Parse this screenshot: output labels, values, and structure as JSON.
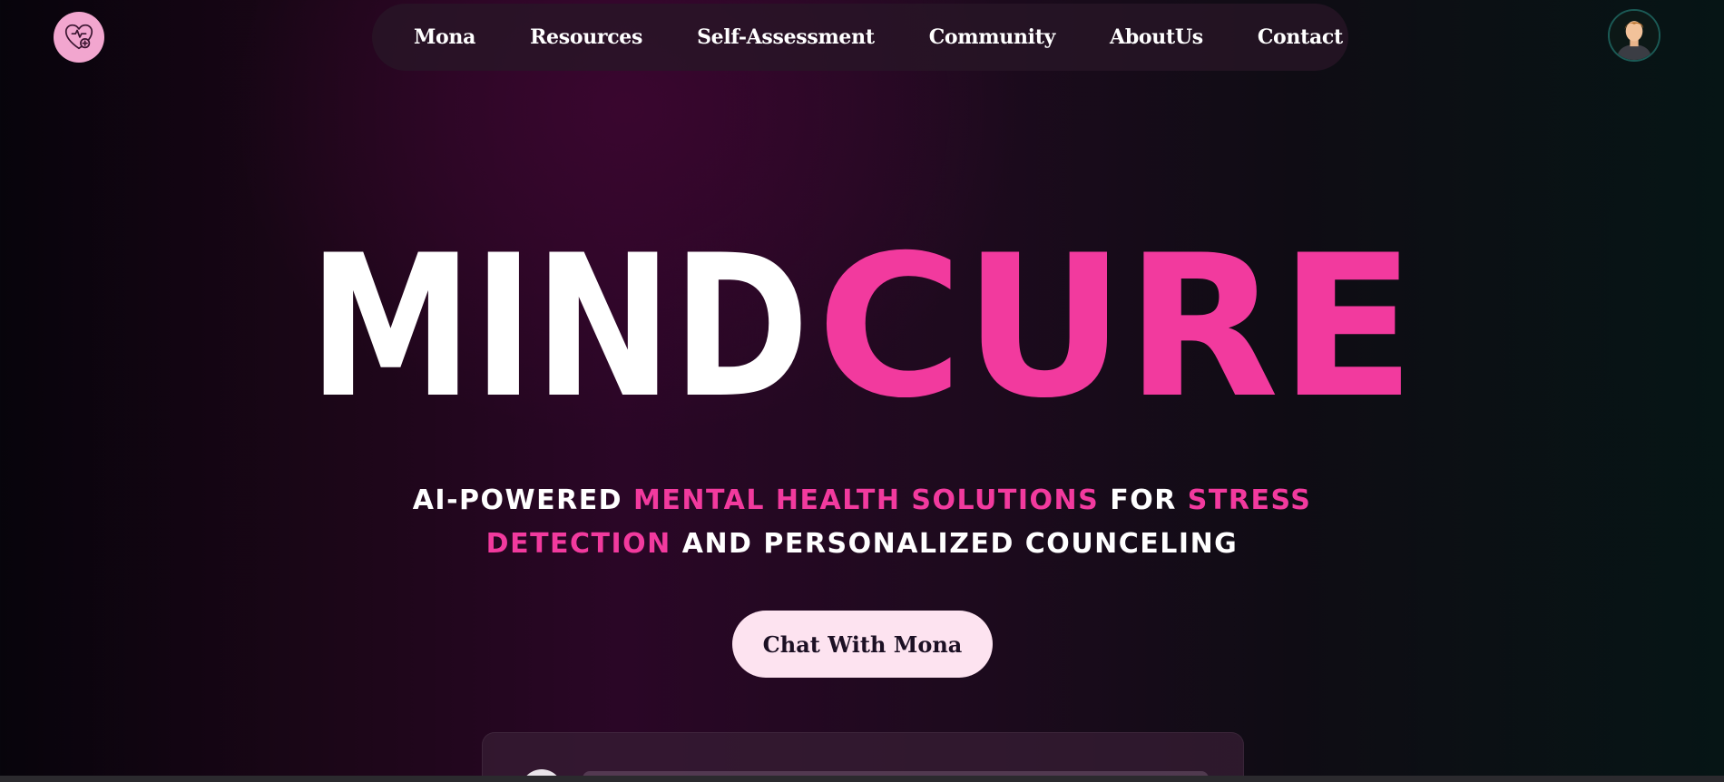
{
  "header": {
    "logo_icon": "heart-plus-icon",
    "avatar_icon": "user-avatar-icon",
    "nav": [
      {
        "label": "Mona"
      },
      {
        "label": "Resources"
      },
      {
        "label": "Self-Assessment"
      },
      {
        "label": "Community"
      },
      {
        "label": "AboutUs"
      },
      {
        "label": "Contact"
      }
    ]
  },
  "hero": {
    "title_part1": "MIND",
    "title_part2": "CURE",
    "tagline": {
      "s1": "AI-POWERED",
      "s2": "MENTAL HEALTH SOLUTIONS",
      "s3": "FOR",
      "s4": "STRESS DETECTION",
      "s5": "AND PERSONALIZED COUNCELING"
    },
    "cta_label": "Chat With Mona"
  },
  "colors": {
    "accent_pink": "#f23a9e",
    "logo_pink": "#f2a6cf",
    "button_bg": "#fde3f0",
    "background_dark": "#1c0618"
  }
}
